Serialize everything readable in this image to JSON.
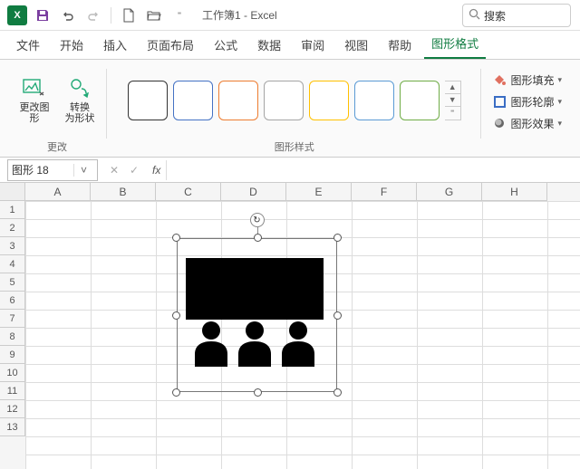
{
  "titlebar": {
    "title": "工作簿1 - Excel"
  },
  "search": {
    "placeholder": "搜索"
  },
  "tabs": [
    "文件",
    "开始",
    "插入",
    "页面布局",
    "公式",
    "数据",
    "审阅",
    "视图",
    "帮助",
    "图形格式"
  ],
  "active_tab": 9,
  "ribbon": {
    "group_change": {
      "label": "更改",
      "change_shape": "更改图\n形",
      "convert_shape": "转换\n为形状"
    },
    "group_styles": {
      "label": "图形样式",
      "swatch_colors": [
        "#333333",
        "#4472c4",
        "#ed7d31",
        "#a5a5a5",
        "#ffc000",
        "#5b9bd5",
        "#70ad47"
      ]
    },
    "group_format": {
      "fill": "图形填充",
      "outline": "图形轮廓",
      "effects": "图形效果"
    }
  },
  "namebox": {
    "value": "图形 18"
  },
  "columns": [
    "A",
    "B",
    "C",
    "D",
    "E",
    "F",
    "G",
    "H"
  ],
  "rows": [
    "1",
    "2",
    "3",
    "4",
    "5",
    "6",
    "7",
    "8",
    "9",
    "10",
    "11",
    "12",
    "13"
  ]
}
